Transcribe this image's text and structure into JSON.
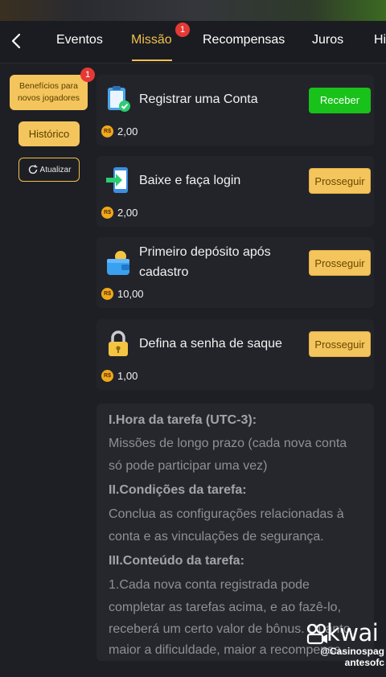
{
  "tabs": [
    {
      "label": "Eventos"
    },
    {
      "label": "Missão",
      "badge": "1",
      "active": true
    },
    {
      "label": "Recompensas"
    },
    {
      "label": "Juros"
    },
    {
      "label": "Hi"
    }
  ],
  "sidebar": {
    "beneficios_line1": "Benefícios para",
    "beneficios_line2": "novos jogadores",
    "beneficios_badge": "1",
    "historico": "Histórico",
    "atualizar": "Atualizar"
  },
  "tasks": [
    {
      "title": "Registrar uma Conta",
      "button": "Receber",
      "currency": "R$",
      "reward": "2,00",
      "icon": "clipboard-check-icon"
    },
    {
      "title": "Baixe e faça login",
      "button": "Prosseguir",
      "currency": "R$",
      "reward": "2,00",
      "icon": "phone-download-icon"
    },
    {
      "title_line1": "Primeiro depósito após",
      "title_line2": "cadastro",
      "button": "Prosseguir",
      "currency": "R$",
      "reward": "10,00",
      "icon": "wallet-icon"
    },
    {
      "title": "Defina a senha de saque",
      "button": "Prosseguir",
      "currency": "R$",
      "reward": "1,00",
      "icon": "lock-icon"
    }
  ],
  "info": {
    "lines": [
      "I.Hora da tarefa (UTC-3):",
      "Missões de longo prazo (cada nova conta",
      "só pode participar uma vez)",
      "II.Condições da tarefa:",
      "Conclua as configurações relacionadas à",
      "conta e as vinculações de segurança.",
      "III.Conteúdo da tarefa:",
      "1.Cada nova conta registrada pode",
      "completar as tarefas acima, e ao fazê-lo,",
      "receberá um certo valor de bônus. Quanto",
      "maior a dificuldade, maior a recompensa."
    ]
  },
  "watermark": {
    "brand": "kwai",
    "user_line1": "@Casinospag",
    "user_line2": "antesofc"
  },
  "colors": {
    "accent": "#f0c04b",
    "receber_green": "#18c21a",
    "badge_red": "#e53935",
    "background": "#1e1f24"
  }
}
